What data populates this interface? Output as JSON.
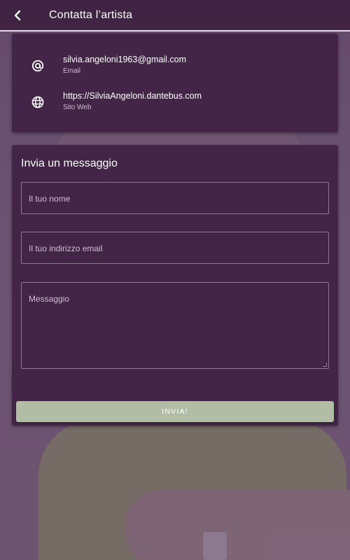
{
  "appbar": {
    "title": "Contatta l’artista",
    "back_icon": "chevron-left-icon",
    "background": "#3f2543"
  },
  "contact": {
    "email": {
      "value": "silvia.angeloni1963@gmail.com",
      "label": "Email",
      "icon": "at-sign-icon"
    },
    "website": {
      "value": "https://SilviaAngeloni.dantebus.com",
      "label": "Sito Web",
      "icon": "globe-icon"
    }
  },
  "form": {
    "title": "Invia un messaggio",
    "name_placeholder": "Il tuo nome",
    "email_placeholder": "Il tuo indirizzo email",
    "message_placeholder": "Messaggio",
    "submit_label": "INVIA!"
  },
  "colors": {
    "card": "#432647",
    "button": "#b2bda6",
    "accent_text": "#ffffff"
  }
}
